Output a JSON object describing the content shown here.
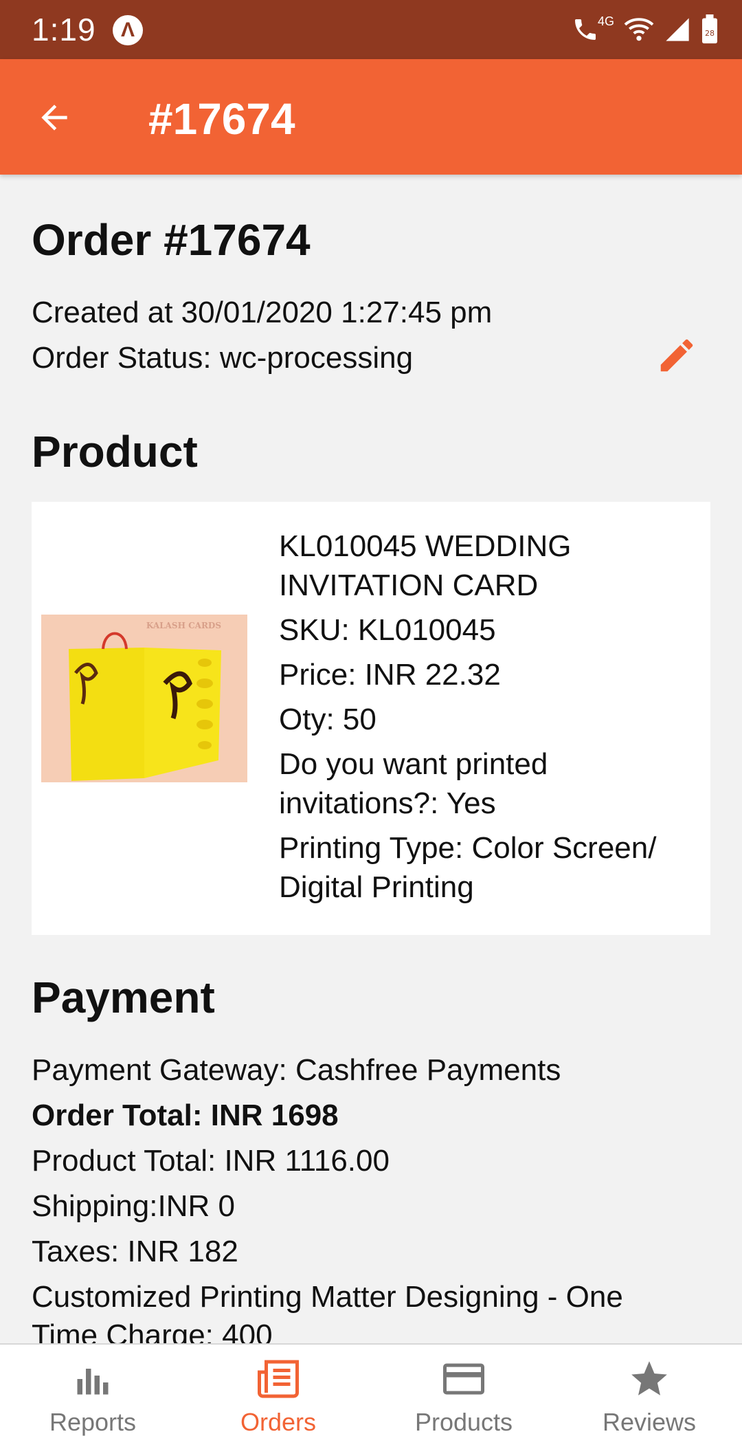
{
  "status_bar": {
    "time": "1:19",
    "network": "4G",
    "battery": "28"
  },
  "app_bar": {
    "title": "#17674"
  },
  "order": {
    "heading": "Order #17674",
    "created": "Created at 30/01/2020 1:27:45 pm",
    "status": "Order Status: wc-processing"
  },
  "product_section": {
    "heading": "Product",
    "thumbnail_brand": "KALASH CARDS",
    "name": "KL010045 WEDDING INVITATION CARD",
    "sku": "SKU: KL010045",
    "price": "Price: INR 22.32",
    "qty": "Oty: 50",
    "printed": "Do you want printed invitations?: Yes",
    "printing_type": "Printing Type: Color Screen/ Digital Printing"
  },
  "payment": {
    "heading": "Payment",
    "gateway": "Payment Gateway: Cashfree Payments",
    "order_total": "Order Total: INR 1698",
    "product_total": "Product Total: INR 1116.00",
    "shipping": "Shipping:INR 0",
    "taxes": "Taxes: INR 182",
    "custom_line1": "Customized Printing Matter Designing - One",
    "custom_line2": "Time Charge: 400"
  },
  "bottom_nav": {
    "items": [
      {
        "label": "Reports",
        "icon": "bar-chart-icon",
        "active": false
      },
      {
        "label": "Orders",
        "icon": "receipt-icon",
        "active": true
      },
      {
        "label": "Products",
        "icon": "card-icon",
        "active": false
      },
      {
        "label": "Reviews",
        "icon": "star-icon",
        "active": false
      }
    ]
  },
  "colors": {
    "status_bar": "#8f3920",
    "app_bar": "#f26334",
    "accent": "#f26334",
    "background": "#f2f2f2"
  }
}
